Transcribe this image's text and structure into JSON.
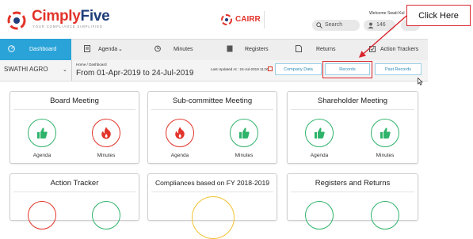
{
  "brand": {
    "name_part1": "Cimply",
    "name_part2": "Five",
    "tagline": "YOUR COMPLIANCE SIMPLIFIED",
    "cairr": "CAIRR"
  },
  "header": {
    "welcome": "Welcome Swati  Kul",
    "search_label": "Search",
    "notif_count": "146"
  },
  "nav": {
    "dashboard": "Dashboard",
    "agenda": "Agenda",
    "minutes": "Minutes",
    "registers": "Registers",
    "returns": "Returns",
    "action_trackers": "Action Trackers"
  },
  "subbar": {
    "company": "SWATHI AGRO",
    "breadcrumb": "Home  /  Dashboard",
    "date_range": "From 01-Apr-2019 to 24-Jul-2019",
    "last_updated": "Last Updated At : 24-Jul-2019 11:00",
    "buttons": {
      "company_data": "Company Data",
      "records": "Records",
      "past_records": "Past Records"
    }
  },
  "callout": "Click Here",
  "cards": {
    "board": {
      "title": "Board Meeting",
      "left": "Agenda",
      "right": "Minutes"
    },
    "subcommittee": {
      "title": "Sub-committee Meeting",
      "left": "Agenda",
      "right": "Minutes"
    },
    "shareholder": {
      "title": "Shareholder Meeting",
      "left": "Agenda",
      "right": "Minutes"
    },
    "action_tracker": {
      "title": "Action Tracker"
    },
    "compliances": {
      "title": "Compliances based on FY 2018-2019"
    },
    "registers_returns": {
      "title": "Registers and Returns"
    }
  },
  "colors": {
    "brand_red": "#e2342a",
    "brand_blue": "#1f3d7a",
    "accent": "#2aa3d8",
    "good": "#2fb36b",
    "bad": "#e2342a",
    "highlight": "#d9262e"
  },
  "icons": [
    "logo-icon",
    "cairr-icon",
    "search-icon",
    "user-icon",
    "dashboard-icon",
    "agenda-icon",
    "minutes-icon",
    "registers-icon",
    "returns-icon",
    "action-trackers-icon",
    "chevron-down-icon",
    "refresh-icon",
    "thumbs-up-icon",
    "fire-icon",
    "cursor-icon"
  ]
}
